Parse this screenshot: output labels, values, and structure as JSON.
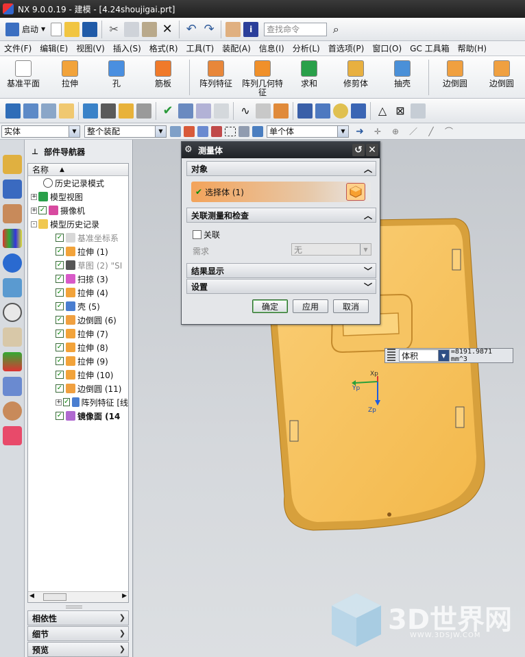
{
  "window": {
    "title": "NX 9.0.0.19 - 建模 - [4.24shoujigai.prt]"
  },
  "standard_toolbar": {
    "start_label": "启动",
    "search_placeholder": "查找命令"
  },
  "menu": [
    "文件(F)",
    "编辑(E)",
    "视图(V)",
    "插入(S)",
    "格式(R)",
    "工具(T)",
    "装配(A)",
    "信息(I)",
    "分析(L)",
    "首选项(P)",
    "窗口(O)",
    "GC 工具箱",
    "帮助(H)"
  ],
  "feature_toolbar": [
    {
      "label": "基准平面",
      "icon": "datum-plane-icon",
      "color": "#ffffff"
    },
    {
      "label": "拉伸",
      "icon": "extrude-icon",
      "color": "#f2a33a"
    },
    {
      "label": "孔",
      "icon": "hole-icon",
      "color": "#4a8fe0"
    },
    {
      "label": "筋板",
      "icon": "rib-icon",
      "color": "#f07a2a"
    },
    {
      "label": "阵列特征",
      "icon": "pattern-feature-icon",
      "color": "#e8873a"
    },
    {
      "label": "阵列几何特征",
      "icon": "pattern-geometry-icon",
      "color": "#f0902a"
    },
    {
      "label": "求和",
      "icon": "unite-icon",
      "color": "#2aa04a"
    },
    {
      "label": "修剪体",
      "icon": "trim-body-icon",
      "color": "#e8b040"
    },
    {
      "label": "抽壳",
      "icon": "shell-icon",
      "color": "#4a90d8"
    },
    {
      "label": "边倒圆",
      "icon": "edge-blend-icon",
      "color": "#f0a040"
    },
    {
      "label": "边倒圆",
      "icon": "edge-blend-icon",
      "color": "#f0a040"
    }
  ],
  "selection_bar": {
    "filter": "实体",
    "scope": "整个装配",
    "body_filter": "单个体"
  },
  "part_navigator": {
    "title": "部件导航器",
    "column": "名称",
    "items": [
      {
        "label": "历史记录模式",
        "indent": 1,
        "check": false,
        "icon": "clock-icon",
        "gray": false,
        "bold": false,
        "expander": ""
      },
      {
        "label": "模型视图",
        "indent": 0,
        "check": false,
        "icon": "model-views-icon",
        "gray": false,
        "bold": false,
        "expander": "+"
      },
      {
        "label": "摄像机",
        "indent": 0,
        "check": true,
        "icon": "camera-icon",
        "gray": false,
        "bold": false,
        "expander": "+"
      },
      {
        "label": "模型历史记录",
        "indent": 0,
        "check": false,
        "icon": "folder-icon",
        "gray": false,
        "bold": false,
        "expander": "-"
      },
      {
        "label": "基准坐标系",
        "indent": 2,
        "check": true,
        "icon": "datum-csys-icon",
        "gray": true,
        "bold": false,
        "expander": ""
      },
      {
        "label": "拉伸 (1)",
        "indent": 2,
        "check": true,
        "icon": "extrude-icon",
        "gray": false,
        "bold": false,
        "expander": ""
      },
      {
        "label": "草图 (2) \"SI",
        "indent": 2,
        "check": true,
        "icon": "sketch-icon",
        "gray": true,
        "bold": false,
        "expander": ""
      },
      {
        "label": "扫掠 (3)",
        "indent": 2,
        "check": true,
        "icon": "sweep-icon",
        "gray": false,
        "bold": false,
        "expander": ""
      },
      {
        "label": "拉伸 (4)",
        "indent": 2,
        "check": true,
        "icon": "extrude-icon",
        "gray": false,
        "bold": false,
        "expander": ""
      },
      {
        "label": "壳 (5)",
        "indent": 2,
        "check": true,
        "icon": "shell-icon",
        "gray": false,
        "bold": false,
        "expander": ""
      },
      {
        "label": "边倒圆 (6)",
        "indent": 2,
        "check": true,
        "icon": "edge-blend-icon",
        "gray": false,
        "bold": false,
        "expander": ""
      },
      {
        "label": "拉伸 (7)",
        "indent": 2,
        "check": true,
        "icon": "extrude-icon",
        "gray": false,
        "bold": false,
        "expander": ""
      },
      {
        "label": "拉伸 (8)",
        "indent": 2,
        "check": true,
        "icon": "extrude-icon",
        "gray": false,
        "bold": false,
        "expander": ""
      },
      {
        "label": "拉伸 (9)",
        "indent": 2,
        "check": true,
        "icon": "extrude-icon",
        "gray": false,
        "bold": false,
        "expander": ""
      },
      {
        "label": "拉伸 (10)",
        "indent": 2,
        "check": true,
        "icon": "extrude-icon",
        "gray": false,
        "bold": false,
        "expander": ""
      },
      {
        "label": "边倒圆 (11)",
        "indent": 2,
        "check": true,
        "icon": "edge-blend-icon",
        "gray": false,
        "bold": false,
        "expander": ""
      },
      {
        "label": "阵列特征 [线",
        "indent": 2,
        "check": true,
        "icon": "pattern-feature-icon",
        "gray": false,
        "bold": false,
        "expander": "+"
      },
      {
        "label": "镜像面 (14",
        "indent": 2,
        "check": true,
        "icon": "mirror-face-icon",
        "gray": false,
        "bold": true,
        "expander": ""
      }
    ],
    "sections": [
      "相依性",
      "细节",
      "预览"
    ]
  },
  "measure_dialog": {
    "title": "测量体",
    "object_group": "对象",
    "select_label": "选择体 (1)",
    "assoc_group": "关联测量和检查",
    "assoc_checkbox": "关联",
    "requirement_label": "需求",
    "requirement_value": "无",
    "results_group": "结果显示",
    "settings_group": "设置",
    "ok": "确定",
    "apply": "应用",
    "cancel": "取消"
  },
  "measure_result": {
    "type": "体积",
    "value": "=8191.9871 mm^3"
  },
  "csys": {
    "x": "Xp",
    "y": "Yp",
    "z": "Zp"
  },
  "watermark": {
    "text": "3D世界网",
    "url": "WWW.3DSJW.COM"
  },
  "colors": {
    "part": "#f9c45a",
    "part_dark": "#d99a2c",
    "accent": "#f0a040",
    "dialog_title": "#2a2d31"
  }
}
